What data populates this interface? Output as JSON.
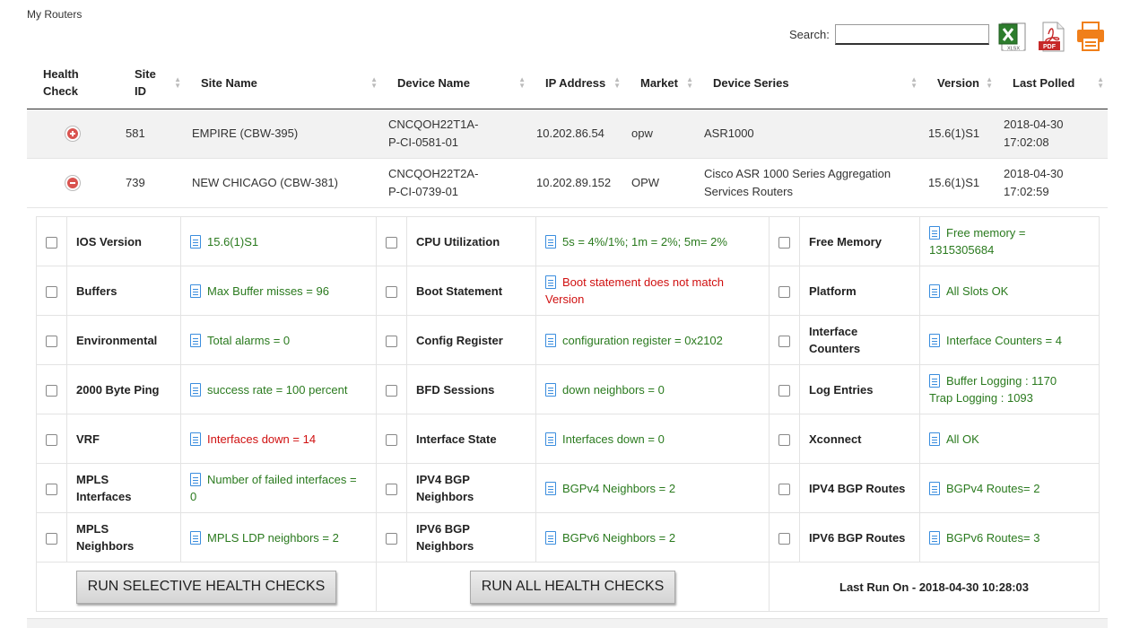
{
  "breadcrumb": "My Routers",
  "search": {
    "label": "Search:",
    "value": ""
  },
  "exports": {
    "xlsx_label": "XLSX",
    "pdf_label": "PDF"
  },
  "colors": {
    "success": "#2a7a1e",
    "error": "#d01010",
    "icon_blue": "#3a8dde",
    "toggle_red": "#d9534f"
  },
  "table": {
    "headers": [
      {
        "line1": "Health",
        "line2": "Check"
      },
      {
        "line1": "Site",
        "line2": "ID"
      },
      {
        "line1": "Site Name",
        "line2": ""
      },
      {
        "line1": "Device Name",
        "line2": ""
      },
      {
        "line1": "IP Address",
        "line2": ""
      },
      {
        "line1": "Market",
        "line2": ""
      },
      {
        "line1": "Device Series",
        "line2": ""
      },
      {
        "line1": "Version",
        "line2": ""
      },
      {
        "line1": "Last Polled",
        "line2": ""
      }
    ],
    "rows": [
      {
        "toggle": "expand-icon",
        "site_id": "581",
        "site_name": "EMPIRE (CBW-395)",
        "device_l1": "CNCQOH22T1A-",
        "device_l2": "P-CI-0581-01",
        "ip": "10.202.86.54",
        "market": "opw",
        "series_l1": "ASR1000",
        "series_l2": "",
        "version": "15.6(1)S1",
        "polled_date": "2018-04-30",
        "polled_time": "17:02:08"
      },
      {
        "toggle": "collapse-icon",
        "site_id": "739",
        "site_name": "NEW CHICAGO (CBW-381)",
        "device_l1": "CNCQOH22T2A-",
        "device_l2": "P-CI-0739-01",
        "ip": "10.202.89.152",
        "market": "OPW",
        "series_l1": "Cisco ASR 1000 Series Aggregation",
        "series_l2": "Services Routers",
        "version": "15.6(1)S1",
        "polled_date": "2018-04-30",
        "polled_time": "17:02:59"
      }
    ]
  },
  "health_checks": {
    "rows": [
      [
        {
          "name": "IOS Version",
          "name2": "",
          "result": "15.6(1)S1",
          "result2": "",
          "status": "ok"
        },
        {
          "name": "CPU Utilization",
          "name2": "",
          "result": "5s = 4%/1%; 1m = 2%; 5m= 2%",
          "result2": "",
          "status": "ok"
        },
        {
          "name": "Free Memory",
          "name2": "",
          "result": "Free memory =",
          "result2": "1315305684",
          "status": "ok"
        }
      ],
      [
        {
          "name": "Buffers",
          "name2": "",
          "result": "Max Buffer misses = 96",
          "result2": "",
          "status": "ok"
        },
        {
          "name": "Boot Statement",
          "name2": "",
          "result": "Boot statement does not match",
          "result2": "Version",
          "status": "error"
        },
        {
          "name": "Platform",
          "name2": "",
          "result": "All Slots OK",
          "result2": "",
          "status": "ok"
        }
      ],
      [
        {
          "name": "Environmental",
          "name2": "",
          "result": "Total alarms = 0",
          "result2": "",
          "status": "ok"
        },
        {
          "name": "Config Register",
          "name2": "",
          "result": "configuration register = 0x2102",
          "result2": "",
          "status": "ok"
        },
        {
          "name": "Interface",
          "name2": "Counters",
          "result": "Interface Counters = 4",
          "result2": "",
          "status": "ok"
        }
      ],
      [
        {
          "name": "2000 Byte Ping",
          "name2": "",
          "result": "success rate = 100 percent",
          "result2": "",
          "status": "ok"
        },
        {
          "name": "BFD Sessions",
          "name2": "",
          "result": "down neighbors = 0",
          "result2": "",
          "status": "ok"
        },
        {
          "name": "Log Entries",
          "name2": "",
          "result": "Buffer Logging : 1170",
          "result2": "Trap Logging : 1093",
          "status": "ok"
        }
      ],
      [
        {
          "name": "VRF",
          "name2": "",
          "result": "Interfaces down = 14",
          "result2": "",
          "status": "error"
        },
        {
          "name": "Interface State",
          "name2": "",
          "result": "Interfaces down = 0",
          "result2": "",
          "status": "ok"
        },
        {
          "name": "Xconnect",
          "name2": "",
          "result": "All OK",
          "result2": "",
          "status": "ok"
        }
      ],
      [
        {
          "name": "MPLS",
          "name2": "Interfaces",
          "result": "Number of failed interfaces =",
          "result2": "0",
          "status": "ok"
        },
        {
          "name": "IPV4 BGP",
          "name2": "Neighbors",
          "result": "BGPv4 Neighbors = 2",
          "result2": "",
          "status": "ok"
        },
        {
          "name": "IPV4 BGP Routes",
          "name2": "",
          "result": "BGPv4 Routes= 2",
          "result2": "",
          "status": "ok"
        }
      ],
      [
        {
          "name": "MPLS",
          "name2": "Neighbors",
          "result": "MPLS LDP neighbors = 2",
          "result2": "",
          "status": "ok"
        },
        {
          "name": "IPV6 BGP",
          "name2": "Neighbors",
          "result": "BGPv6 Neighbors = 2",
          "result2": "",
          "status": "ok"
        },
        {
          "name": "IPV6 BGP Routes",
          "name2": "",
          "result": "BGPv6 Routes= 3",
          "result2": "",
          "status": "ok"
        }
      ]
    ],
    "run_selective_label": "RUN SELECTIVE HEALTH CHECKS",
    "run_all_label": "RUN ALL HEALTH CHECKS",
    "last_run": "Last Run On - 2018-04-30 10:28:03"
  }
}
